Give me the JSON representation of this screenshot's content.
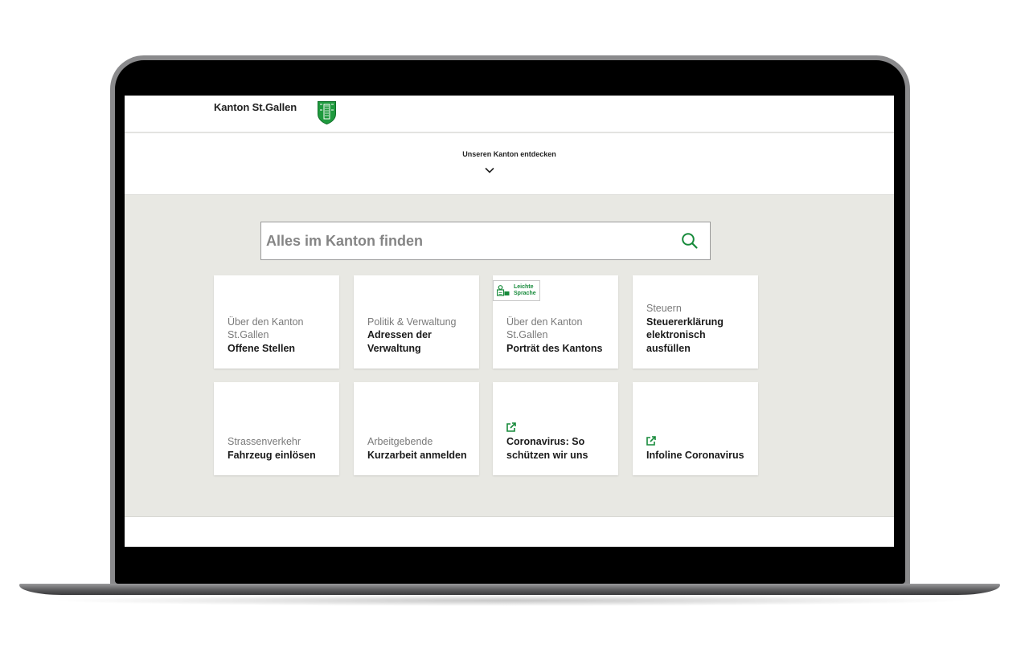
{
  "site": {
    "brand_name": "Kanton St.Gallen",
    "discover_label": "Unseren Kanton entdecken"
  },
  "search": {
    "placeholder": "Alles im Kanton finden"
  },
  "badge": {
    "line1": "Leichte",
    "line2": "Sprache"
  },
  "tiles": [
    {
      "category": "Über den Kanton St.Gallen",
      "title": "Offene Stellen",
      "external": false
    },
    {
      "category": "Politik & Verwaltung",
      "title": "Adressen der Verwaltung",
      "external": false
    },
    {
      "category": "Über den Kanton St.Gallen",
      "title": "Porträt des Kantons",
      "external": false,
      "badge": true
    },
    {
      "category": "Steuern",
      "title": "Steuererklärung elektronisch ausfüllen",
      "external": false
    },
    {
      "category": "Strassenverkehr",
      "title": "Fahrzeug einlösen",
      "external": false
    },
    {
      "category": "Arbeitgebende",
      "title": "Kurzarbeit anmelden",
      "external": false
    },
    {
      "category": "",
      "title": "Coronavirus: So schützen wir uns",
      "external": true
    },
    {
      "category": "",
      "title": "Infoline Coronavirus",
      "external": true
    }
  ],
  "colors": {
    "brand_green": "#168a3a",
    "page_bg": "#e8e8e3"
  },
  "icons": {
    "search": "search-icon",
    "chevron": "chevron-down-icon",
    "external": "external-link-icon",
    "crest": "coat-of-arms-icon"
  }
}
